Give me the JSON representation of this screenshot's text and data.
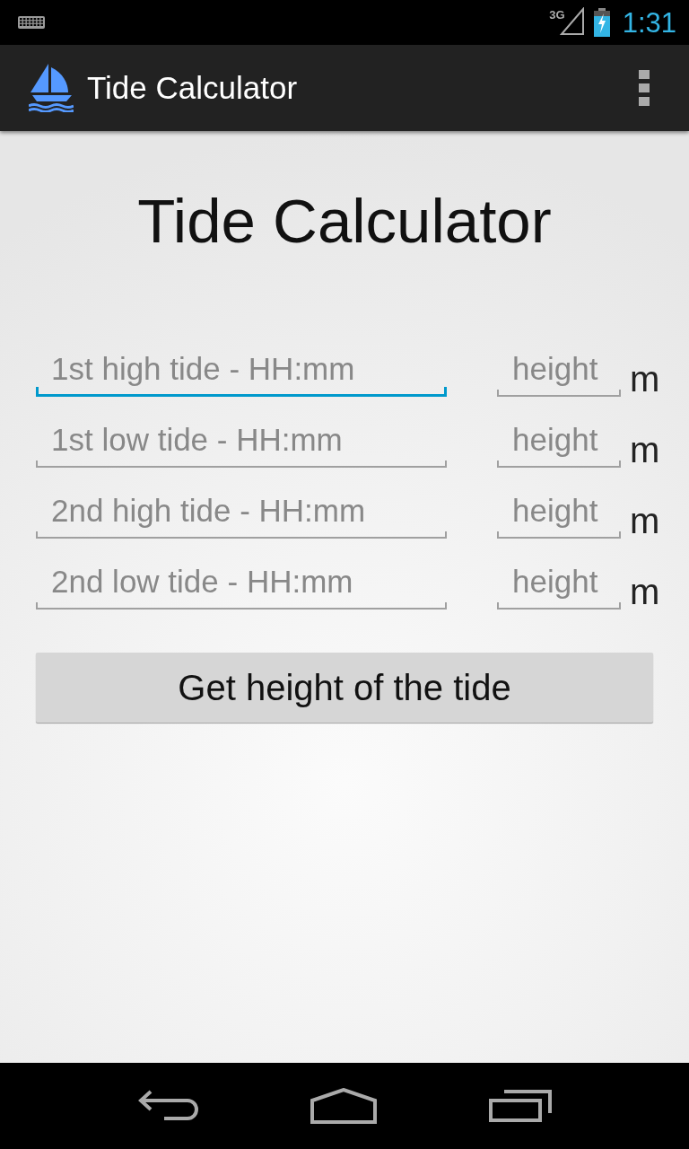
{
  "status_bar": {
    "network": "3G",
    "time": "1:31"
  },
  "action_bar": {
    "title": "Tide Calculator"
  },
  "heading": "Tide Calculator",
  "tides": [
    {
      "time_placeholder": "1st high tide - HH:mm",
      "focused": true,
      "height_placeholder": "height",
      "unit": "m"
    },
    {
      "time_placeholder": "1st low tide - HH:mm",
      "focused": false,
      "height_placeholder": "height",
      "unit": "m"
    },
    {
      "time_placeholder": "2nd high tide - HH:mm",
      "focused": false,
      "height_placeholder": "height",
      "unit": "m"
    },
    {
      "time_placeholder": "2nd low tide - HH:mm",
      "focused": false,
      "height_placeholder": "height",
      "unit": "m"
    }
  ],
  "button": "Get height of the tide"
}
